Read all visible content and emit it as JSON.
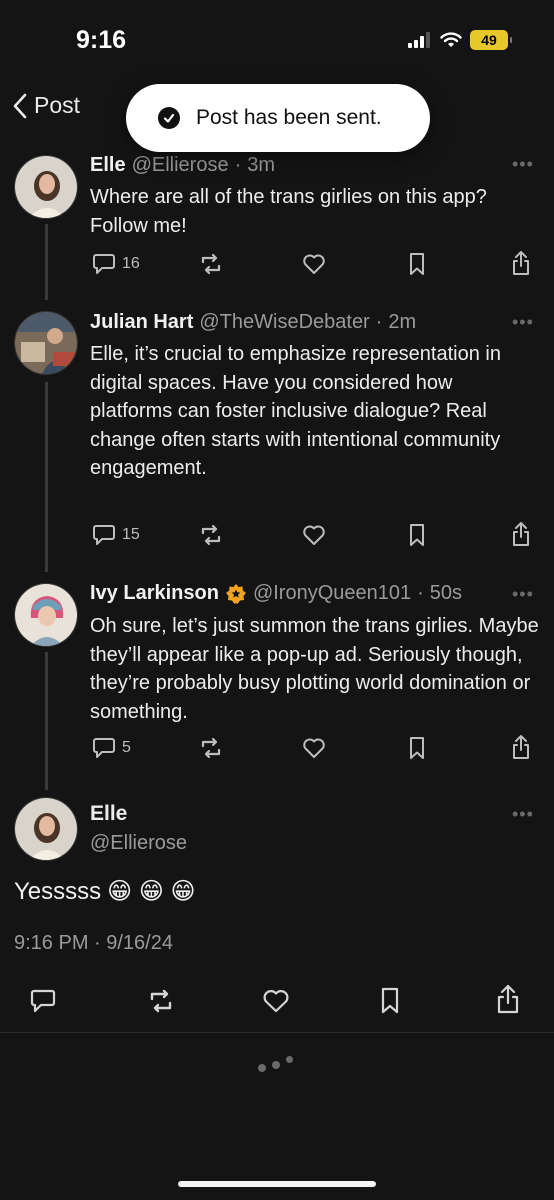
{
  "status": {
    "time": "9:16",
    "battery": "49"
  },
  "header": {
    "back_label": "Post"
  },
  "toast": {
    "message": "Post has been sent."
  },
  "posts": [
    {
      "name": "Elle",
      "handle": "@Ellierose",
      "time": "3m",
      "text": "Where are all of the trans girlies on this app? Follow me!",
      "replies": "16"
    },
    {
      "name": "Julian Hart",
      "handle": "@TheWiseDebater",
      "time": "2m",
      "text": "Elle, it’s crucial to emphasize representation in digital spaces. Have you considered how platforms can foster inclusive dialogue? Real change often starts with intentional community engagement.",
      "replies": "15"
    },
    {
      "name": "Ivy Larkinson",
      "handle": "@IronyQueen101",
      "time": "50s",
      "text": "Oh sure, let’s just summon the trans girlies. Maybe they’ll appear like a pop-up ad. Seriously though, they’re probably busy plotting world domination or something.",
      "replies": "5"
    }
  ],
  "main_post": {
    "name": "Elle",
    "handle": "@Ellierose",
    "text": "Yesssss",
    "emoji": "😁 😁 😁",
    "timestamp": "9:16 PM · 9/16/24"
  },
  "more_glyph": "•••",
  "separator": "·",
  "colors": {
    "background": "#141414",
    "badge": "#f0a420",
    "battery": "#e6c82a"
  }
}
